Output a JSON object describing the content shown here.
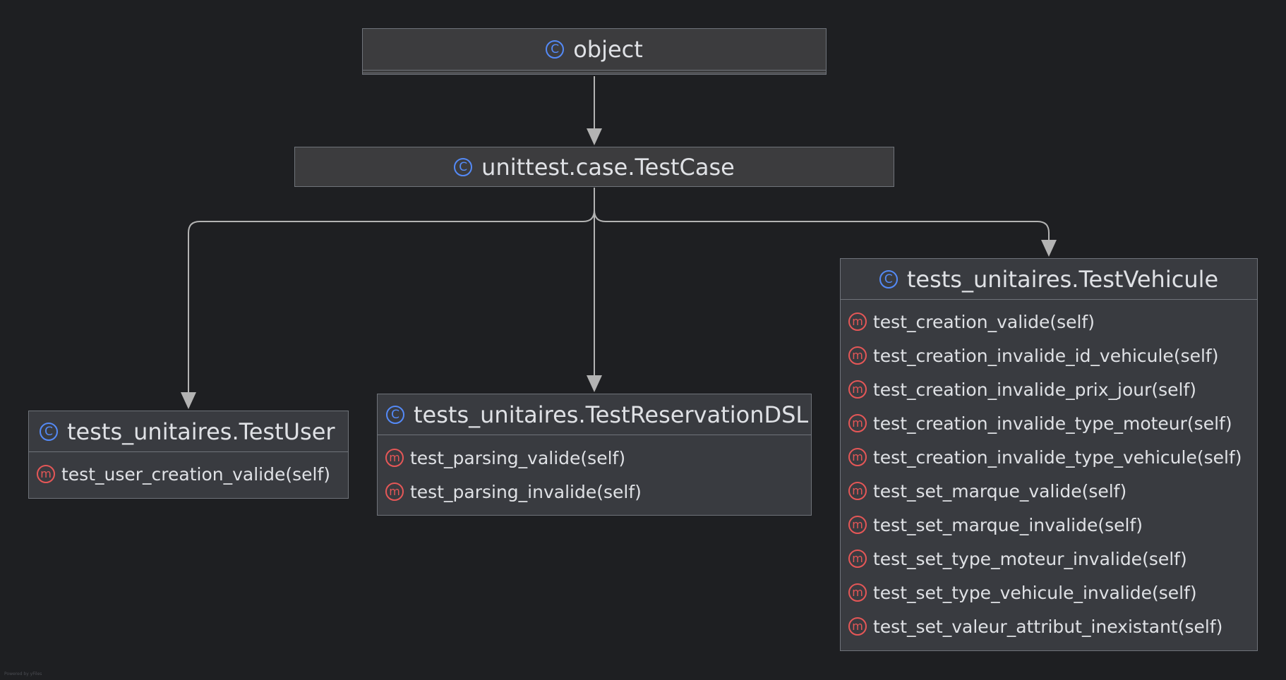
{
  "colors": {
    "background": "#1e1f22",
    "node": "#393b40",
    "border": "#6f737a",
    "edge": "#b3b3b3",
    "class_icon": "#548af7",
    "method_icon": "#e55757"
  },
  "icons": {
    "class": "C",
    "method": "m"
  },
  "classes": {
    "object": {
      "name": "object"
    },
    "testcase": {
      "name": "unittest.case.TestCase"
    },
    "testuser": {
      "name": "tests_unitaires.TestUser",
      "methods": [
        "test_user_creation_valide(self)"
      ]
    },
    "testreservation": {
      "name": "tests_unitaires.TestReservationDSL",
      "methods": [
        "test_parsing_valide(self)",
        "test_parsing_invalide(self)"
      ]
    },
    "testvehicule": {
      "name": "tests_unitaires.TestVehicule",
      "methods": [
        "test_creation_valide(self)",
        "test_creation_invalide_id_vehicule(self)",
        "test_creation_invalide_prix_jour(self)",
        "test_creation_invalide_type_moteur(self)",
        "test_creation_invalide_type_vehicule(self)",
        "test_set_marque_valide(self)",
        "test_set_marque_invalide(self)",
        "test_set_type_moteur_invalide(self)",
        "test_set_type_vehicule_invalide(self)",
        "test_set_valeur_attribut_inexistant(self)"
      ]
    }
  },
  "edges": [
    {
      "from": "unittest.case.TestCase",
      "to": "object"
    },
    {
      "from": "tests_unitaires.TestUser",
      "to": "unittest.case.TestCase"
    },
    {
      "from": "tests_unitaires.TestReservationDSL",
      "to": "unittest.case.TestCase"
    },
    {
      "from": "tests_unitaires.TestVehicule",
      "to": "unittest.case.TestCase"
    }
  ],
  "footer": "Powered by yFiles"
}
